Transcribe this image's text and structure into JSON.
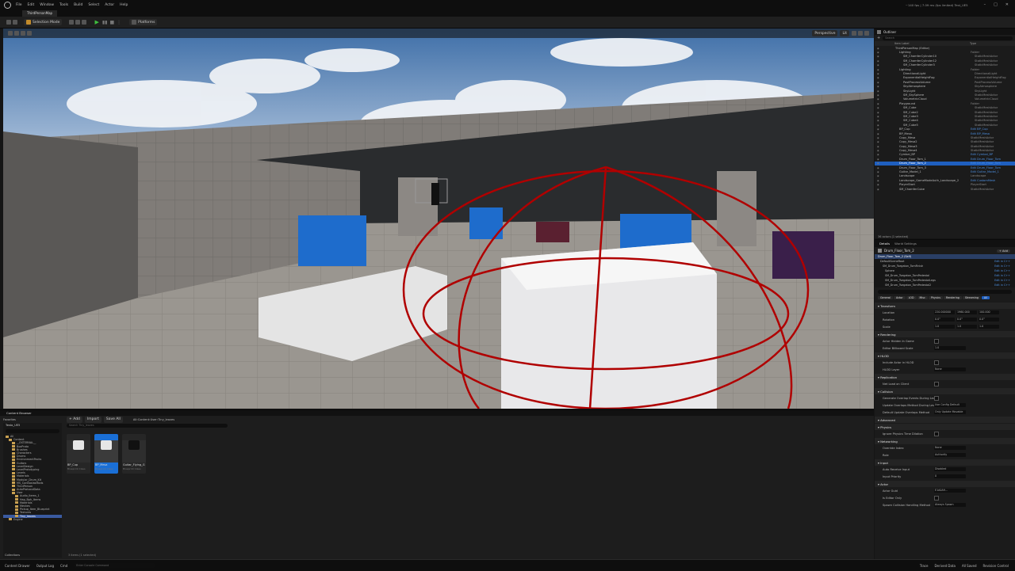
{
  "app": {
    "title_info": "~140 fps | 7.09 ms (fps limited)   Test_UE5",
    "menu": [
      "File",
      "Edit",
      "Window",
      "Tools",
      "Build",
      "Select",
      "Actor",
      "Help"
    ],
    "tab": "ThirdPersonMap"
  },
  "toolbar": {
    "mode": "Selection Mode",
    "platforms": "Platforms",
    "play_icon": "play-icon"
  },
  "viewport": {
    "view_mode": "Perspective",
    "lit": "Lit"
  },
  "outliner": {
    "title": "Outliner",
    "search_placeholder": "Search",
    "col_label": "Item Label",
    "col_type": "Type",
    "rows": [
      {
        "name": "ThirdPersonMap (Editor)",
        "type": "",
        "indent": 3,
        "sel": false,
        "link": false
      },
      {
        "name": "Lighting",
        "type": "Folder",
        "indent": 4,
        "sel": false,
        "link": false
      },
      {
        "name": "SM_ChamferCylinder10",
        "type": "StaticMeshActor",
        "indent": 5,
        "sel": false,
        "link": false
      },
      {
        "name": "SM_ChamferCylinder12",
        "type": "StaticMeshActor",
        "indent": 5,
        "sel": false,
        "link": false
      },
      {
        "name": "SM_ChamferCylinder3",
        "type": "StaticMeshActor",
        "indent": 5,
        "sel": false,
        "link": false
      },
      {
        "name": "Lighting",
        "type": "Folder",
        "indent": 4,
        "sel": false,
        "link": false
      },
      {
        "name": "DirectionalLight",
        "type": "DirectionalLight",
        "indent": 5,
        "sel": false,
        "link": false
      },
      {
        "name": "ExponentialHeightFog",
        "type": "ExponentialHeightFog",
        "indent": 5,
        "sel": false,
        "link": false
      },
      {
        "name": "PostProcessVolume",
        "type": "PostProcessVolume",
        "indent": 5,
        "sel": false,
        "link": false
      },
      {
        "name": "SkyAtmosphere",
        "type": "SkyAtmosphere",
        "indent": 5,
        "sel": false,
        "link": false
      },
      {
        "name": "SkyLight",
        "type": "SkyLight",
        "indent": 5,
        "sel": false,
        "link": false
      },
      {
        "name": "SM_SkySphere",
        "type": "StaticMeshActor",
        "indent": 5,
        "sel": false,
        "link": false
      },
      {
        "name": "VolumetricCloud",
        "type": "VolumetricCloud",
        "indent": 5,
        "sel": false,
        "link": false
      },
      {
        "name": "Playground",
        "type": "Folder",
        "indent": 4,
        "sel": false,
        "link": false
      },
      {
        "name": "SM_Cube",
        "type": "StaticMeshActor",
        "indent": 5,
        "sel": false,
        "link": false
      },
      {
        "name": "SM_Cube2",
        "type": "StaticMeshActor",
        "indent": 5,
        "sel": false,
        "link": false
      },
      {
        "name": "SM_Cube3",
        "type": "StaticMeshActor",
        "indent": 5,
        "sel": false,
        "link": false
      },
      {
        "name": "SM_Cube4",
        "type": "StaticMeshActor",
        "indent": 5,
        "sel": false,
        "link": false
      },
      {
        "name": "SM_Cube5",
        "type": "StaticMeshActor",
        "indent": 5,
        "sel": false,
        "link": false
      },
      {
        "name": "BP_Cup",
        "type": "Edit BP_Cup",
        "indent": 4,
        "sel": false,
        "link": true
      },
      {
        "name": "BP_Mesa",
        "type": "Edit BP_Mesa",
        "indent": 4,
        "sel": false,
        "link": true
      },
      {
        "name": "Copy_Mesa",
        "type": "StaticMeshActor",
        "indent": 4,
        "sel": false,
        "link": false
      },
      {
        "name": "Copy_Mesa2",
        "type": "StaticMeshActor",
        "indent": 4,
        "sel": false,
        "link": false
      },
      {
        "name": "Copy_Mesa3",
        "type": "StaticMeshActor",
        "indent": 4,
        "sel": false,
        "link": false
      },
      {
        "name": "Copy_Mesa4",
        "type": "StaticMeshActor",
        "indent": 4,
        "sel": false,
        "link": false
      },
      {
        "name": "Cymbal_BP",
        "type": "Edit Cymbal_BP",
        "indent": 4,
        "sel": false,
        "link": true
      },
      {
        "name": "Drum_Floor_Tom_1",
        "type": "Edit Drum_Floor_Tom",
        "indent": 4,
        "sel": false,
        "link": true
      },
      {
        "name": "Drum_Floor_Tom_2",
        "type": "Edit Drum_Floor_Tom",
        "indent": 4,
        "sel": true,
        "link": true
      },
      {
        "name": "Drum_Floor_Tom_3",
        "type": "Edit Drum_Floor_Tom",
        "indent": 4,
        "sel": false,
        "link": true
      },
      {
        "name": "Guitar_Model_1",
        "type": "Edit Guitar_Model_1",
        "indent": 4,
        "sel": false,
        "link": true
      },
      {
        "name": "Landscape",
        "type": "Landscape",
        "indent": 4,
        "sel": false,
        "link": false
      },
      {
        "name": "Landscape_GameModeAuth_Landscape_2",
        "type": "Edit CustomMesh",
        "indent": 4,
        "sel": false,
        "link": true
      },
      {
        "name": "PlayerStart",
        "type": "PlayerStart",
        "indent": 4,
        "sel": false,
        "link": false
      },
      {
        "name": "SM_ChamferCube",
        "type": "StaticMeshActor",
        "indent": 4,
        "sel": false,
        "link": false
      }
    ],
    "footer": "36 actors (1 selected)"
  },
  "details": {
    "tabs": [
      "Details",
      "World Settings"
    ],
    "actor_name": "Drum_Floor_Tom_2",
    "add_label": "+ Add",
    "components": [
      {
        "name": "Drum_Floor_Tom_2 (Self)",
        "link": ""
      },
      {
        "name": "DefaultSceneRoot",
        "link": "Edit in C++"
      },
      {
        "name": "SM_Drum_Tsegaton_TomFinish",
        "link": "Edit in C++"
      },
      {
        "name": "Sphere",
        "link": "Edit in C++"
      },
      {
        "name": "SM_Drum_Tsegaton_TomPedestal",
        "link": "Edit in C++"
      },
      {
        "name": "SM_Drum_Tsegaton_TomPedestalLegs",
        "link": "Edit in C++"
      },
      {
        "name": "SM_Drum_Tsegaton_TomPedestal2",
        "link": "Edit in C++"
      }
    ],
    "filter_tabs": [
      "General",
      "Actor",
      "LOD",
      "Misc",
      "Physics",
      "Rendering",
      "Streaming",
      "All"
    ],
    "sections": [
      {
        "head": "Transform",
        "rows": [
          {
            "label": "Location",
            "v": [
              "220.000000",
              "1960.000",
              "100.000"
            ]
          },
          {
            "label": "Rotation",
            "v": [
              "0.0°",
              "0.0°",
              "0.0°"
            ]
          },
          {
            "label": "Scale",
            "v": [
              "1.0",
              "1.0",
              "1.0"
            ]
          }
        ]
      },
      {
        "head": "Rendering",
        "rows": [
          {
            "label": "Actor Hidden In Game",
            "v": [
              ""
            ]
          },
          {
            "label": "Editor Billboard Scale",
            "v": [
              "1.0"
            ]
          }
        ]
      },
      {
        "head": "HLOD",
        "rows": [
          {
            "label": "Include Actor in HLOD",
            "v": [
              ""
            ]
          },
          {
            "label": "HLOD Layer",
            "v": [
              "None"
            ]
          }
        ]
      },
      {
        "head": "Replication",
        "rows": [
          {
            "label": "Net Load on Client",
            "v": [
              ""
            ]
          }
        ]
      },
      {
        "head": "Collision",
        "rows": [
          {
            "label": "Generate Overlap Events During Level Streaming",
            "v": [
              ""
            ]
          },
          {
            "label": "Update Overlaps Method During Level Streaming",
            "v": [
              "Use Config Default"
            ]
          },
          {
            "label": "Default Update Overlaps Method",
            "v": [
              "Only Update Movable"
            ]
          }
        ]
      },
      {
        "head": "Advanced",
        "rows": []
      },
      {
        "head": "Physics",
        "rows": [
          {
            "label": "Ignore Physics Time Dilation",
            "v": [
              ""
            ]
          }
        ]
      },
      {
        "head": "Networking",
        "rows": [
          {
            "label": "Override Index",
            "v": [
              "None"
            ]
          },
          {
            "label": "Role",
            "v": [
              "Authority"
            ]
          }
        ]
      },
      {
        "head": "Input",
        "rows": [
          {
            "label": "Auto Receive Input",
            "v": [
              "Disabled"
            ]
          },
          {
            "label": "Input Priority",
            "v": [
              "0"
            ]
          }
        ]
      },
      {
        "head": "Actor",
        "rows": [
          {
            "label": "Actor Guid",
            "v": [
              "E1A0A9..."
            ]
          },
          {
            "label": "Is Editor Only",
            "v": [
              ""
            ]
          },
          {
            "label": "Spawn Collision Handling Method",
            "v": [
              "Always Spawn"
            ]
          }
        ]
      }
    ]
  },
  "content_browser": {
    "tab": "Content Browser",
    "add": "+ Add",
    "import": "Import",
    "save_all": "Save All",
    "favorites": "Favorites",
    "project": "Testo_UE5",
    "path": [
      "All",
      "Content",
      "User",
      "Tiny_leaves"
    ],
    "search_placeholder": "Search Tiny_leaves",
    "tree": [
      {
        "name": "All",
        "indent": 0,
        "sel": false
      },
      {
        "name": "Content",
        "indent": 1,
        "sel": false
      },
      {
        "name": "__EXTERNAL__",
        "indent": 2,
        "sel": false
      },
      {
        "name": "BoxProto",
        "indent": 2,
        "sel": false
      },
      {
        "name": "Brushes",
        "indent": 2,
        "sel": false
      },
      {
        "name": "Characters",
        "indent": 2,
        "sel": false
      },
      {
        "name": "Drums",
        "indent": 2,
        "sel": false
      },
      {
        "name": "EnvironmentPacks",
        "indent": 2,
        "sel": false
      },
      {
        "name": "Guitars",
        "indent": 2,
        "sel": false
      },
      {
        "name": "LevelDesign",
        "indent": 2,
        "sel": false
      },
      {
        "name": "LevelPrototyping",
        "indent": 2,
        "sel": false
      },
      {
        "name": "Levels",
        "indent": 2,
        "sel": false
      },
      {
        "name": "Materials",
        "indent": 2,
        "sel": false
      },
      {
        "name": "Modular_Drum_Kit",
        "indent": 2,
        "sel": false
      },
      {
        "name": "MS_ConBoxlasMods",
        "indent": 2,
        "sel": false
      },
      {
        "name": "ThirdPerson",
        "indent": 2,
        "sel": false
      },
      {
        "name": "AutoProtocolData",
        "indent": 2,
        "sel": false
      },
      {
        "name": "User",
        "indent": 2,
        "sel": false
      },
      {
        "name": "Audio_Items_1",
        "indent": 3,
        "sel": false
      },
      {
        "name": "Hap_Bph_Items",
        "indent": 3,
        "sel": false
      },
      {
        "name": "Materials",
        "indent": 3,
        "sel": false
      },
      {
        "name": "Meshes",
        "indent": 3,
        "sel": false
      },
      {
        "name": "Pickup_Item_Blueprint",
        "indent": 3,
        "sel": false
      },
      {
        "name": "Textures",
        "indent": 3,
        "sel": false
      },
      {
        "name": "Tiny_leaves",
        "indent": 3,
        "sel": true
      },
      {
        "name": "Engine",
        "indent": 1,
        "sel": false
      }
    ],
    "assets": [
      {
        "name": "BP_Cup",
        "sub": "Blueprint Class",
        "sel": false,
        "thumb": "light"
      },
      {
        "name": "BP_Mesa",
        "sub": "Blueprint Class",
        "sel": true,
        "thumb": "light"
      },
      {
        "name": "Guitar_Flying_G",
        "sub": "Blueprint Class",
        "sel": false,
        "thumb": "dark"
      }
    ],
    "status": "3 items (1 selected)",
    "collections": "Collections"
  },
  "statusbar": {
    "items": [
      "Content Drawer",
      "Output Log",
      "Cmd"
    ],
    "cmd_placeholder": "Enter Console Command",
    "right": [
      "Trace",
      "Derived Data",
      "All Saved",
      "Revision Control"
    ]
  }
}
